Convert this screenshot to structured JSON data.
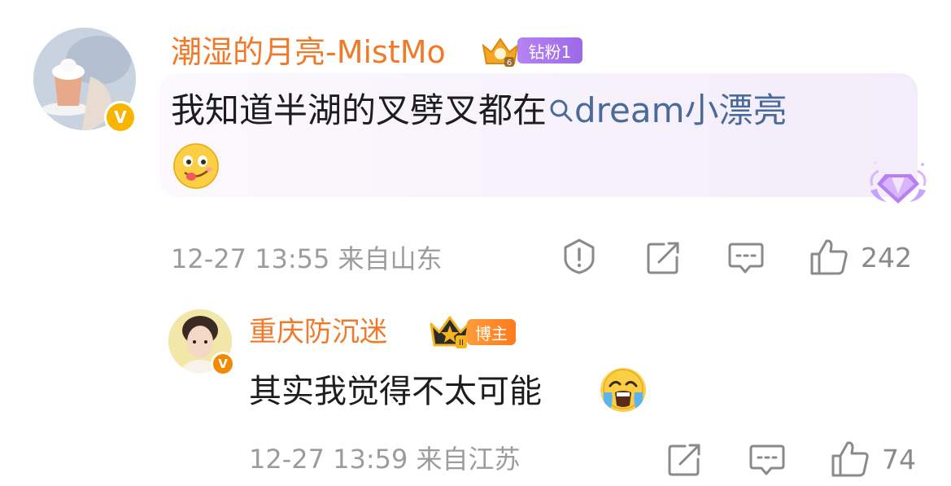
{
  "comments": [
    {
      "username": "潮湿的月亮-MistMo",
      "badge_label": "钻粉1",
      "content_text": "我知道半湖的叉劈叉都在",
      "mention_text": "dream小漂亮",
      "timestamp": "12-27 13:55",
      "location": "来自山东",
      "like_count": "242"
    },
    {
      "username": "重庆防沉迷",
      "badge_label": "博主",
      "content_text": "其实我觉得不太可能",
      "timestamp": "12-27 13:59",
      "location": "来自江苏",
      "like_count": "74"
    }
  ],
  "colors": {
    "username": "#f07a2a",
    "meta": "#9c9c9c",
    "link": "#4a6a9a",
    "badge_fan": "#a974ee",
    "badge_owner": "#ff8a2a",
    "verify": "#f7b500"
  },
  "icons": [
    "verified-icon",
    "crown-icon",
    "search-icon",
    "report-icon",
    "repost-icon",
    "reply-icon",
    "like-icon",
    "diamond-badge-icon"
  ]
}
